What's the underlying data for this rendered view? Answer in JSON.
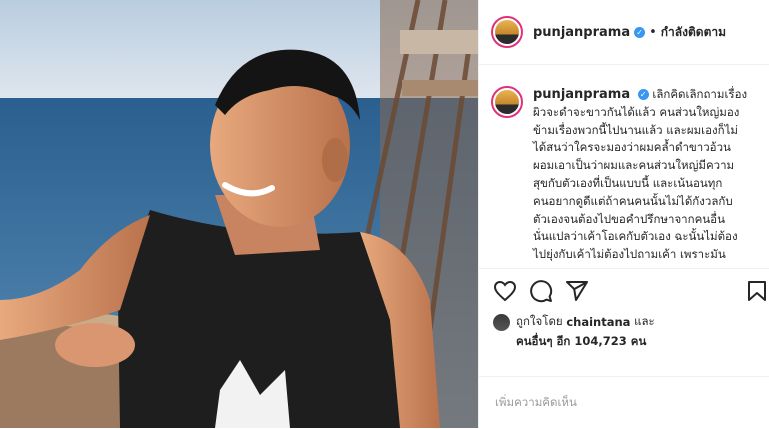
{
  "post": {
    "username": "punjanprama",
    "separator": "•",
    "follow_label": "กำลังติดตาม",
    "caption_lines": [
      "เลิกคิดเลิกถามเรื่อง",
      "ผิวจะดำจะขาวกันได้แล้ว คนส่วนใหญ่มอง",
      "ข้ามเรื่องพวกนี้ไปนานแล้ว และผมเองก็ไม่",
      "ได้สนว่าใครจะมองว่าผมคล้ำดำขาวอ้วน",
      "ผอมเอาเป็นว่าผมและคนส่วนใหญ่มีความ",
      "สุขกับตัวเองที่เป็นแบบนี้ และเน้นอนทุก",
      "คนอยากดูดีแต่ถ้าคนคนนั้นไม่ได้กังวลกับ",
      "ตัวเองจนต้องไปขอคำปรึกษาจากคนอื่น",
      "นั่นแปลว่าเค้าโอเคกับตัวเอง ฉะนั้นไม่ต้อง",
      "ไปยุ่งกับเค้าไม่ต้องไปถามเค้า เพราะมัน"
    ],
    "likes_line1_prefix": "ถูกใจโดย",
    "likes_user": "chaintana",
    "likes_line1_suffix": "และ",
    "likes_line2": "คนอื่นๆ อีก 104,723 คน",
    "comment_placeholder": "เพิ่มความคิดเห็น",
    "icons": [
      "heart-icon",
      "comment-icon",
      "share-icon",
      "bookmark-icon",
      "verified-icon"
    ],
    "colors": {
      "verified": "#3897f0",
      "ring": "#e0317a",
      "text": "#262626",
      "muted": "#999999"
    }
  }
}
